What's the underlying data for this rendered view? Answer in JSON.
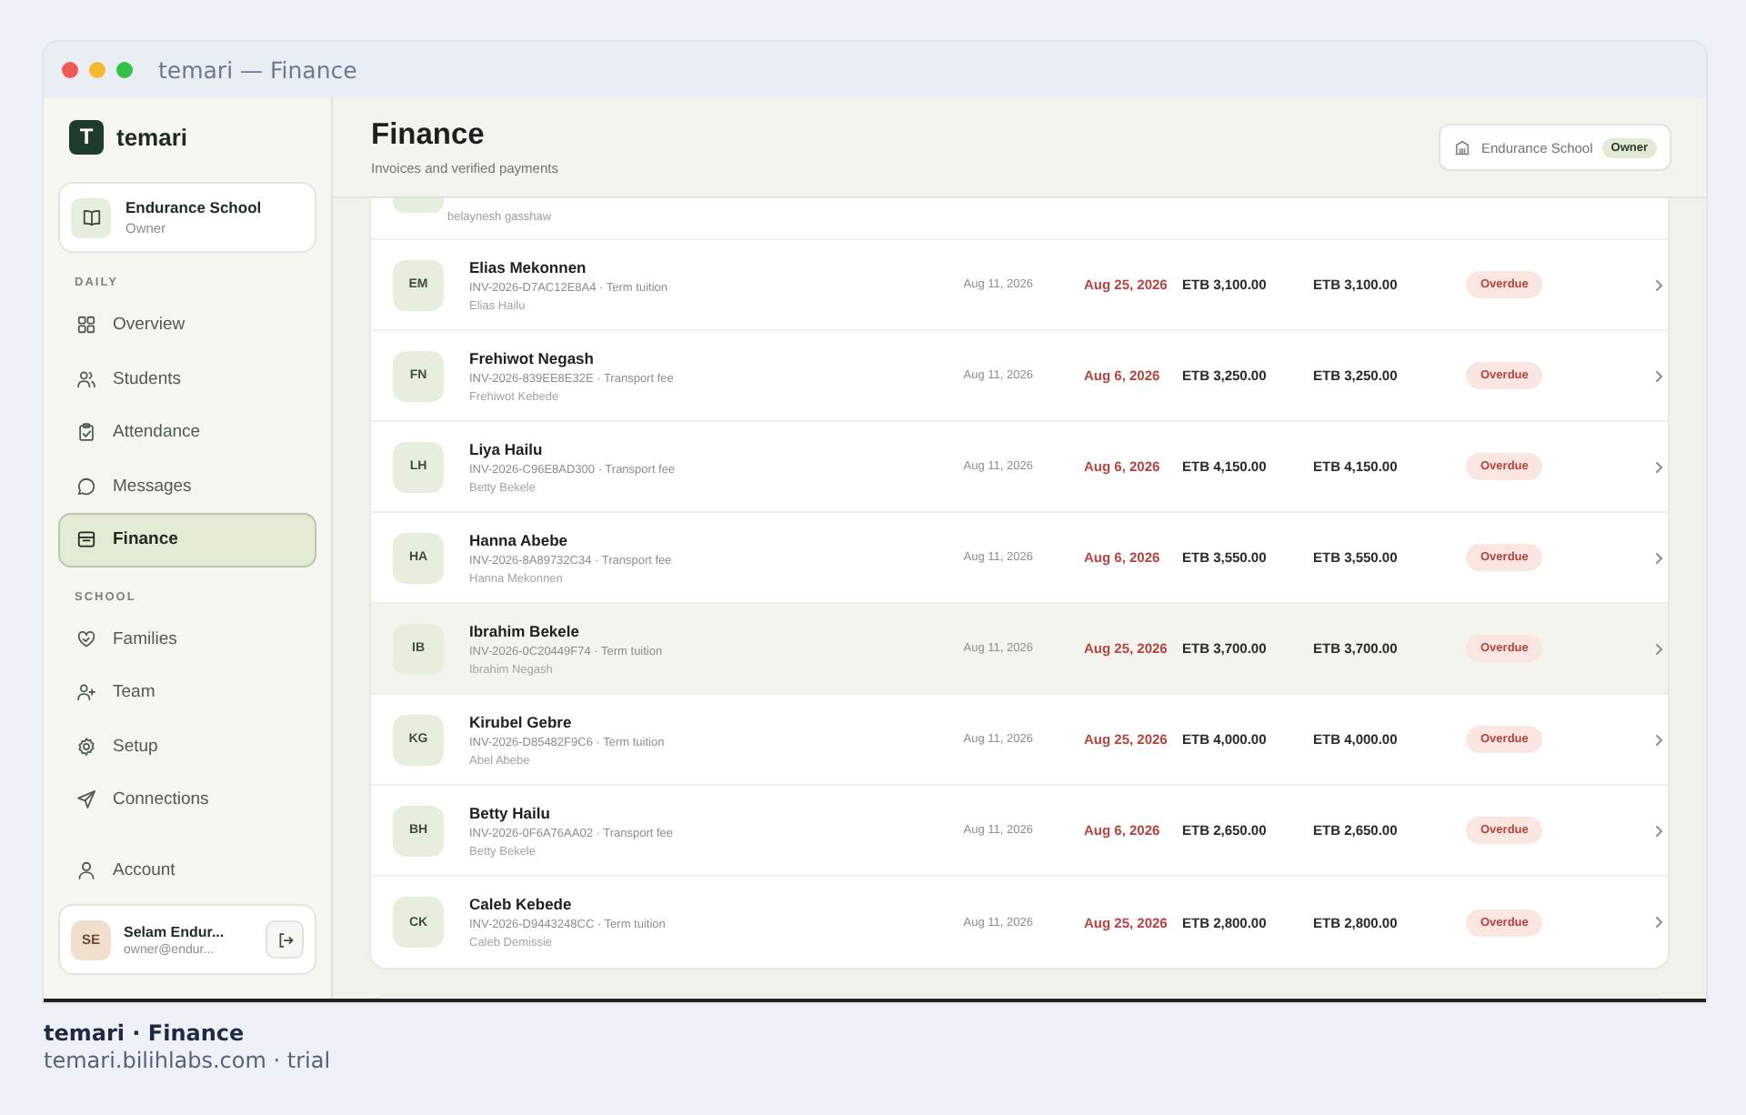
{
  "window": {
    "title": "temari — Finance"
  },
  "sidebar": {
    "brand": "temari",
    "brand_initial": "T",
    "school": {
      "name": "Endurance School",
      "role": "Owner"
    },
    "sections": [
      {
        "heading": "DAILY",
        "items": [
          {
            "label": "Overview",
            "selected": false
          },
          {
            "label": "Students",
            "selected": false
          },
          {
            "label": "Attendance",
            "selected": false
          },
          {
            "label": "Messages",
            "selected": false
          },
          {
            "label": "Finance",
            "selected": true
          }
        ]
      },
      {
        "heading": "SCHOOL",
        "items": [
          {
            "label": "Families",
            "selected": false
          },
          {
            "label": "Team",
            "selected": false
          },
          {
            "label": "Setup",
            "selected": false
          },
          {
            "label": "Connections",
            "selected": false
          }
        ]
      }
    ],
    "account": {
      "label": "Account",
      "selected": false
    },
    "user": {
      "initials": "SE",
      "name": "Selam Endur...",
      "email": "owner@endur..."
    }
  },
  "header": {
    "title": "Finance",
    "subtitle": "Invoices and verified payments",
    "school_chip": {
      "name": "Endurance School",
      "role": "Owner"
    }
  },
  "invoices": {
    "partial_row": {
      "guardian": "belaynesh gasshaw"
    },
    "rows": [
      {
        "initials": "EM",
        "student": "Elias Mekonnen",
        "invoice": "INV-2026-D7AC12E8A4 · Term tuition",
        "guardian": "Elias Hailu",
        "issued": "Aug 11, 2026",
        "due": "Aug 25, 2026",
        "amount": "ETB 3,100.00",
        "balance": "ETB 3,100.00",
        "status": "Overdue",
        "highlighted": false
      },
      {
        "initials": "FN",
        "student": "Frehiwot Negash",
        "invoice": "INV-2026-839EE8E32E · Transport fee",
        "guardian": "Frehiwot Kebede",
        "issued": "Aug 11, 2026",
        "due": "Aug 6, 2026",
        "amount": "ETB 3,250.00",
        "balance": "ETB 3,250.00",
        "status": "Overdue",
        "highlighted": false
      },
      {
        "initials": "LH",
        "student": "Liya Hailu",
        "invoice": "INV-2026-C96E8AD300 · Transport fee",
        "guardian": "Betty Bekele",
        "issued": "Aug 11, 2026",
        "due": "Aug 6, 2026",
        "amount": "ETB 4,150.00",
        "balance": "ETB 4,150.00",
        "status": "Overdue",
        "highlighted": false
      },
      {
        "initials": "HA",
        "student": "Hanna Abebe",
        "invoice": "INV-2026-8A89732C34 · Transport fee",
        "guardian": "Hanna Mekonnen",
        "issued": "Aug 11, 2026",
        "due": "Aug 6, 2026",
        "amount": "ETB 3,550.00",
        "balance": "ETB 3,550.00",
        "status": "Overdue",
        "highlighted": false
      },
      {
        "initials": "IB",
        "student": "Ibrahim Bekele",
        "invoice": "INV-2026-0C20449F74 · Term tuition",
        "guardian": "Ibrahim Negash",
        "issued": "Aug 11, 2026",
        "due": "Aug 25, 2026",
        "amount": "ETB 3,700.00",
        "balance": "ETB 3,700.00",
        "status": "Overdue",
        "highlighted": true
      },
      {
        "initials": "KG",
        "student": "Kirubel Gebre",
        "invoice": "INV-2026-D85482F9C6 · Term tuition",
        "guardian": "Abel Abebe",
        "issued": "Aug 11, 2026",
        "due": "Aug 25, 2026",
        "amount": "ETB 4,000.00",
        "balance": "ETB 4,000.00",
        "status": "Overdue",
        "highlighted": false
      },
      {
        "initials": "BH",
        "student": "Betty Hailu",
        "invoice": "INV-2026-0F6A76AA02 · Transport fee",
        "guardian": "Betty Bekele",
        "issued": "Aug 11, 2026",
        "due": "Aug 6, 2026",
        "amount": "ETB 2,650.00",
        "balance": "ETB 2,650.00",
        "status": "Overdue",
        "highlighted": false
      },
      {
        "initials": "CK",
        "student": "Caleb Kebede",
        "invoice": "INV-2026-D9443248CC · Term tuition",
        "guardian": "Caleb Demissie",
        "issued": "Aug 11, 2026",
        "due": "Aug 25, 2026",
        "amount": "ETB 2,800.00",
        "balance": "ETB 2,800.00",
        "status": "Overdue",
        "highlighted": false
      }
    ]
  },
  "caption": {
    "title": "temari · Finance",
    "subtitle": "temari.bilihlabs.com · trial"
  }
}
